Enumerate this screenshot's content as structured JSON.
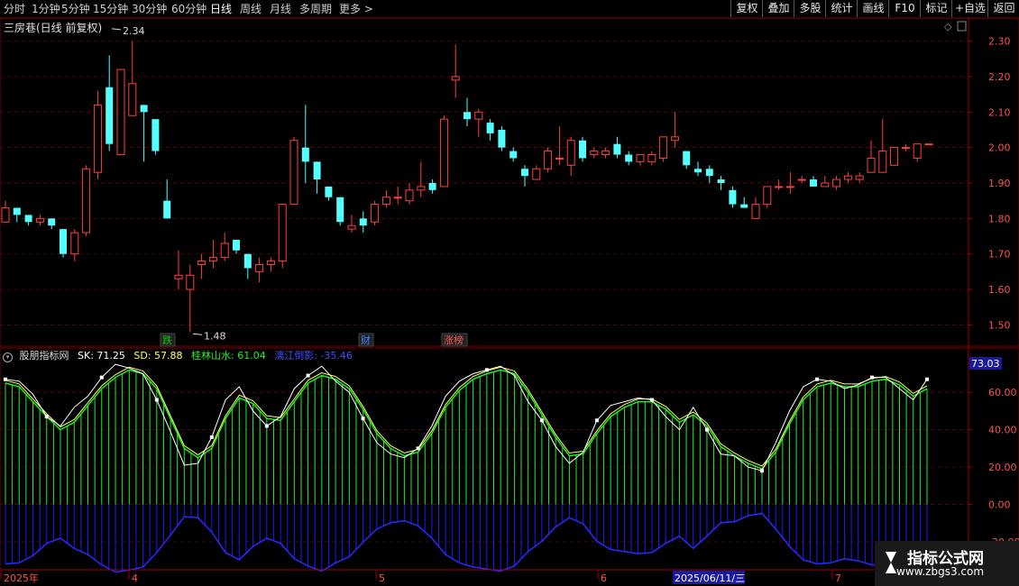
{
  "toolbar": {
    "periods": [
      "分时",
      "1分钟",
      "5分钟",
      "15分钟",
      "30分钟",
      "60分钟",
      "日线",
      "周线",
      "月线",
      "多周期",
      "更多 >"
    ],
    "active_period": "日线",
    "buttons": [
      "复权",
      "叠加",
      "多股",
      "统计",
      "画线",
      "F10",
      "标记",
      "+自选",
      "返回"
    ]
  },
  "stock": {
    "title": "三房巷(日线 前复权)"
  },
  "price_axis": {
    "ticks": [
      "2.30",
      "2.20",
      "2.10",
      "2.00",
      "1.90",
      "1.80",
      "1.70",
      "1.60",
      "1.50"
    ],
    "min": 1.44,
    "max": 2.365
  },
  "annotations": {
    "high": "2.34",
    "low": "1.48"
  },
  "events": [
    {
      "label": "跌",
      "color": "#00d000"
    },
    {
      "label": "财",
      "color": "#3f7fff"
    },
    {
      "label": "涨榜",
      "color": "#ff5a5a"
    }
  ],
  "indicator": {
    "name": "股朋指标网",
    "sk_label": "SK: 71.25",
    "sd_label": "SD: 57.88",
    "line3_label": "桂林山水: 61.04",
    "line4_label": "漓江倒影: -35.46",
    "current_value": "73.03",
    "axis_ticks": [
      "60.00",
      "40.00",
      "20.00",
      "0.00",
      "-20.00"
    ],
    "min": -35,
    "max": 77
  },
  "date_axis": {
    "labels": [
      "2025年",
      "4",
      "5",
      "6",
      "7"
    ],
    "selected_date": "2025/06/11/三"
  },
  "watermark": {
    "title": "指标公式网",
    "url": "www.zbgs3.com"
  },
  "colors": {
    "up": "#ff4040",
    "down": "#54ffff",
    "grid": "#7a0000",
    "sk": "#ffffff",
    "sd": "#ffff66",
    "green": "#22ee22",
    "blue": "#1a1aff"
  },
  "chart_data": {
    "type": "candlestick",
    "candles": [
      [
        1.79,
        1.83,
        1.85,
        1.79
      ],
      [
        1.83,
        1.81,
        1.83,
        1.79
      ],
      [
        1.81,
        1.79,
        1.81,
        1.78
      ],
      [
        1.79,
        1.8,
        1.81,
        1.78
      ],
      [
        1.8,
        1.78,
        1.8,
        1.77
      ],
      [
        1.77,
        1.7,
        1.77,
        1.69
      ],
      [
        1.7,
        1.76,
        1.77,
        1.68
      ],
      [
        1.76,
        1.94,
        1.95,
        1.75
      ],
      [
        1.93,
        2.12,
        2.16,
        1.91
      ],
      [
        2.17,
        2.01,
        2.26,
        1.99
      ],
      [
        1.98,
        2.22,
        2.22,
        1.98
      ],
      [
        2.09,
        2.18,
        2.3,
        2.09
      ],
      [
        2.12,
        2.1,
        2.12,
        1.96
      ],
      [
        2.08,
        1.99,
        2.08,
        1.98
      ],
      [
        1.85,
        1.8,
        1.91,
        1.8
      ],
      [
        1.63,
        1.64,
        1.71,
        1.6
      ],
      [
        1.6,
        1.64,
        1.67,
        1.48
      ],
      [
        1.67,
        1.68,
        1.7,
        1.63
      ],
      [
        1.68,
        1.69,
        1.74,
        1.66
      ],
      [
        1.69,
        1.73,
        1.76,
        1.68
      ],
      [
        1.74,
        1.71,
        1.74,
        1.7
      ],
      [
        1.7,
        1.66,
        1.7,
        1.63
      ],
      [
        1.65,
        1.67,
        1.69,
        1.62
      ],
      [
        1.67,
        1.68,
        1.69,
        1.65
      ],
      [
        1.68,
        1.84,
        1.84,
        1.66
      ],
      [
        1.84,
        2.02,
        2.03,
        1.84
      ],
      [
        2.0,
        1.96,
        2.12,
        1.9
      ],
      [
        1.96,
        1.91,
        1.96,
        1.87
      ],
      [
        1.89,
        1.86,
        1.89,
        1.85
      ],
      [
        1.86,
        1.79,
        1.86,
        1.78
      ],
      [
        1.77,
        1.78,
        1.81,
        1.76
      ],
      [
        1.8,
        1.78,
        1.82,
        1.76
      ],
      [
        1.79,
        1.84,
        1.85,
        1.78
      ],
      [
        1.84,
        1.86,
        1.88,
        1.83
      ],
      [
        1.86,
        1.86,
        1.89,
        1.84
      ],
      [
        1.85,
        1.88,
        1.9,
        1.84
      ],
      [
        1.88,
        1.89,
        1.96,
        1.86
      ],
      [
        1.9,
        1.88,
        1.91,
        1.87
      ],
      [
        1.89,
        2.08,
        2.09,
        1.89
      ],
      [
        2.19,
        2.2,
        2.29,
        2.14
      ],
      [
        2.1,
        2.08,
        2.14,
        2.06
      ],
      [
        2.08,
        2.1,
        2.11,
        2.03
      ],
      [
        2.07,
        2.04,
        2.08,
        2.02
      ],
      [
        2.05,
        2.0,
        2.06,
        1.99
      ],
      [
        1.99,
        1.97,
        2.0,
        1.96
      ],
      [
        1.94,
        1.92,
        1.95,
        1.89
      ],
      [
        1.91,
        1.94,
        1.95,
        1.91
      ],
      [
        1.94,
        1.99,
        2.0,
        1.93
      ],
      [
        1.97,
        1.97,
        2.06,
        1.95
      ],
      [
        1.95,
        2.02,
        2.03,
        1.92
      ],
      [
        2.02,
        1.97,
        2.03,
        1.96
      ],
      [
        1.98,
        1.99,
        2.0,
        1.97
      ],
      [
        1.98,
        1.99,
        2.0,
        1.97
      ],
      [
        2.01,
        1.98,
        2.03,
        1.97
      ],
      [
        1.98,
        1.96,
        1.99,
        1.95
      ],
      [
        1.96,
        1.98,
        1.98,
        1.95
      ],
      [
        1.96,
        1.98,
        1.99,
        1.95
      ],
      [
        1.97,
        2.03,
        2.03,
        1.96
      ],
      [
        2.02,
        2.03,
        2.1,
        2.0
      ],
      [
        1.99,
        1.95,
        1.99,
        1.94
      ],
      [
        1.94,
        1.93,
        1.96,
        1.92
      ],
      [
        1.94,
        1.92,
        1.95,
        1.9
      ],
      [
        1.91,
        1.9,
        1.92,
        1.88
      ],
      [
        1.88,
        1.84,
        1.89,
        1.83
      ],
      [
        1.84,
        1.83,
        1.86,
        1.83
      ],
      [
        1.8,
        1.84,
        1.86,
        1.8
      ],
      [
        1.84,
        1.89,
        1.89,
        1.83
      ],
      [
        1.89,
        1.89,
        1.91,
        1.88
      ],
      [
        1.89,
        1.89,
        1.93,
        1.87
      ],
      [
        1.91,
        1.91,
        1.92,
        1.9
      ],
      [
        1.91,
        1.89,
        1.92,
        1.89
      ],
      [
        1.89,
        1.9,
        1.92,
        1.89
      ],
      [
        1.89,
        1.91,
        1.92,
        1.88
      ],
      [
        1.91,
        1.92,
        1.93,
        1.9
      ],
      [
        1.91,
        1.92,
        1.93,
        1.9
      ],
      [
        1.93,
        1.97,
        2.02,
        1.93
      ],
      [
        1.93,
        1.99,
        2.08,
        1.93
      ],
      [
        1.95,
        2.0,
        2.0,
        1.95
      ],
      [
        2.0,
        2.0,
        2.01,
        1.99
      ],
      [
        1.97,
        2.01,
        2.01,
        1.96
      ],
      [
        2.01,
        2.01,
        2.01,
        2.01
      ]
    ],
    "sk": [
      67,
      66,
      59,
      47,
      42,
      52,
      58,
      68,
      75,
      73,
      70,
      56,
      39,
      21,
      22,
      36,
      56,
      63,
      50,
      42,
      47,
      62,
      69,
      74,
      66,
      60,
      46,
      33,
      27,
      25,
      30,
      42,
      58,
      66,
      70,
      72,
      74,
      69,
      55,
      45,
      31,
      22,
      28,
      45,
      53,
      55,
      57,
      56,
      47,
      40,
      52,
      40,
      27,
      26,
      20,
      18,
      33,
      50,
      63,
      67,
      66,
      62,
      64,
      68,
      68,
      62,
      56,
      67
    ],
    "sd": [
      65,
      63,
      55,
      47,
      40,
      44,
      53,
      62,
      68,
      72,
      70,
      62,
      46,
      30,
      25,
      30,
      46,
      57,
      54,
      46,
      45,
      55,
      65,
      69,
      67,
      62,
      51,
      38,
      30,
      26,
      28,
      38,
      52,
      61,
      67,
      70,
      72,
      70,
      60,
      48,
      36,
      26,
      27,
      38,
      47,
      52,
      55,
      55,
      51,
      44,
      48,
      42,
      31,
      26,
      22,
      19,
      28,
      43,
      56,
      63,
      65,
      63,
      63,
      66,
      67,
      64,
      58,
      62
    ]
  }
}
